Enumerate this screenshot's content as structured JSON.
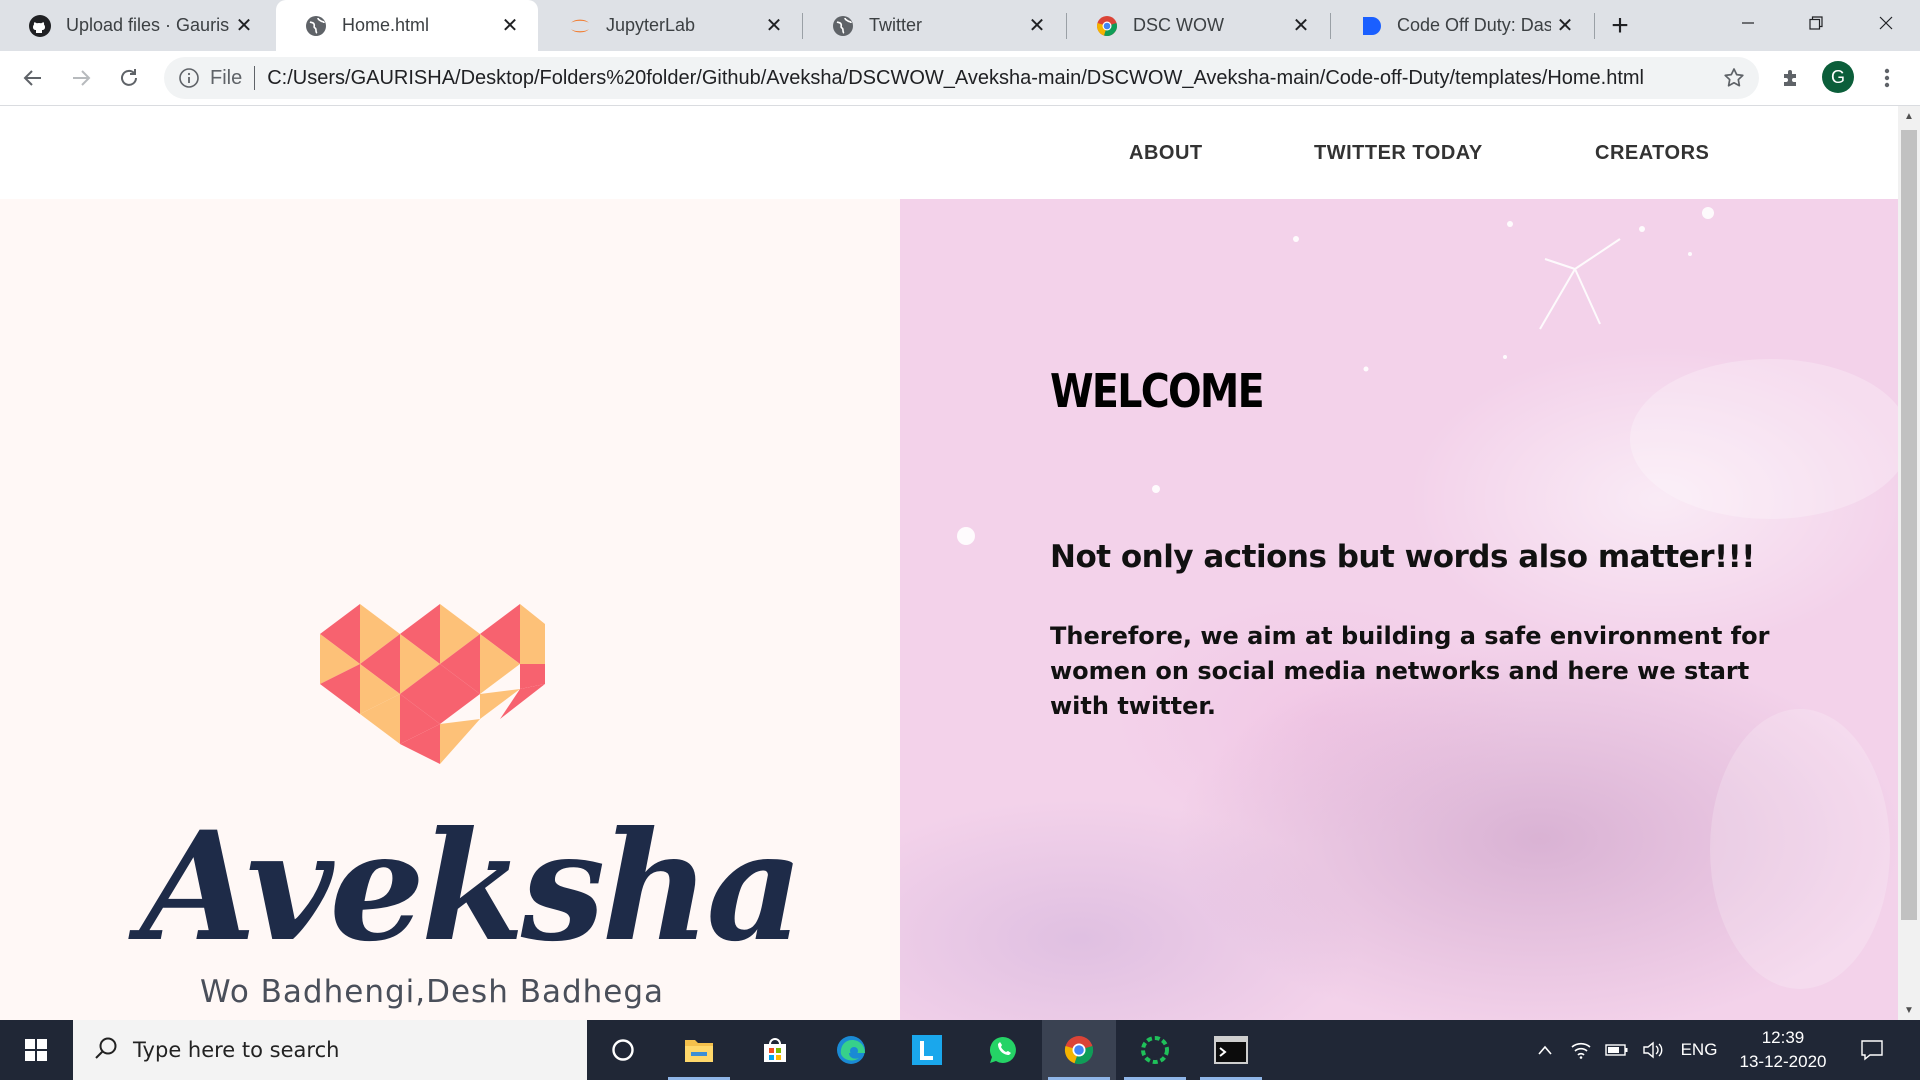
{
  "browser": {
    "tabs": [
      {
        "title": "Upload files · Gaurisha",
        "icon": "github-icon",
        "active": false
      },
      {
        "title": "Home.html",
        "icon": "globe-icon",
        "active": true
      },
      {
        "title": "JupyterLab",
        "icon": "jupyter-icon",
        "active": false
      },
      {
        "title": "Twitter",
        "icon": "globe-icon",
        "active": false
      },
      {
        "title": "DSC WOW",
        "icon": "chrome-icon",
        "active": false
      },
      {
        "title": "Code Off Duty: Dashboard",
        "icon": "devpost-icon",
        "active": false
      }
    ],
    "address": {
      "scheme_label": "File",
      "url": "C:/Users/GAURISHA/Desktop/Folders%20folder/Github/Aveksha/DSCWOW_Aveksha-main/DSCWOW_Aveksha-main/Code-off-Duty/templates/Home.html"
    },
    "profile_initial": "G"
  },
  "site": {
    "nav": [
      "ABOUT",
      "TWITTER TODAY",
      "CREATORS"
    ],
    "hero": {
      "heading": "WELCOME",
      "tagline": "Not only actions but words also matter!!!",
      "body": "Therefore, we aim at building a safe environment for women on social media networks and here we start with twitter."
    },
    "logo": {
      "brand": "Aveksha",
      "slogan": "Wo Badhengi,Desh Badhega",
      "colors": {
        "pink": "#f7626f",
        "peach": "#fdc178",
        "navy": "#1e2b48"
      }
    }
  },
  "taskbar": {
    "search_placeholder": "Type here to search",
    "apps": [
      "cortana-icon",
      "file-explorer-icon",
      "store-icon",
      "edge-icon",
      "l-app-icon",
      "whatsapp-icon",
      "chrome-icon",
      "loading-app-icon",
      "terminal-icon"
    ],
    "language": "ENG",
    "time": "12:39",
    "date": "13-12-2020"
  }
}
